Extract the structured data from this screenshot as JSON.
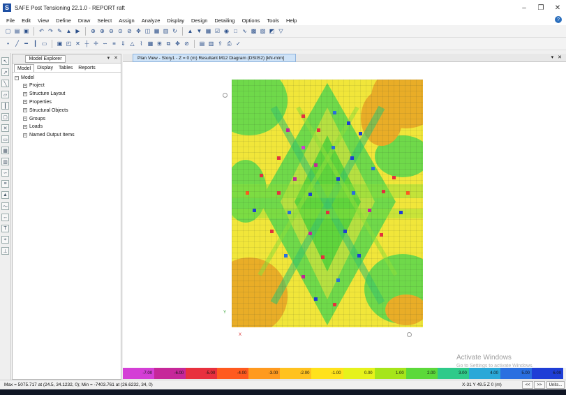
{
  "window": {
    "title": "SAFE Post Tensioning 22.1.0 - REPORT raft",
    "icon_letter": "S",
    "minimize": "–",
    "restore": "❐",
    "close": "✕"
  },
  "menu": [
    "File",
    "Edit",
    "View",
    "Define",
    "Draw",
    "Select",
    "Assign",
    "Analyze",
    "Display",
    "Design",
    "Detailing",
    "Options",
    "Tools",
    "Help"
  ],
  "explorer": {
    "title": "Model Explorer",
    "pin": "▾",
    "close": "✕",
    "tabs": [
      "Model",
      "Display",
      "Tables",
      "Reports"
    ],
    "root": "Model",
    "items": [
      "Project",
      "Structure Layout",
      "Properties",
      "Structural Objects",
      "Groups",
      "Loads",
      "Named Output Items"
    ]
  },
  "plan_view": {
    "tab_title": "Plan View - Story1 - Z = 0 (m)   Resultant M12 Diagram   (DStlS2)  [kN-m/m]",
    "close": "✕",
    "x_axis_label": "X",
    "y_axis_label": "Y"
  },
  "legend": {
    "values": [
      "-7.00",
      "-6.00",
      "-5.00",
      "-4.00",
      "-3.00",
      "-2.00",
      "-1.00",
      "0.00",
      "1.00",
      "2.00",
      "3.00",
      "4.00",
      "5.00",
      "6.00"
    ],
    "colors": [
      "#d43fd6",
      "#c6279a",
      "#e8303e",
      "#ff5a1f",
      "#ff9a1f",
      "#ffc21f",
      "#ffe21c",
      "#e6f21c",
      "#a6e51a",
      "#5cd93a",
      "#2fca8a",
      "#2aa8d8",
      "#2a6fe0",
      "#1f3ed6"
    ]
  },
  "status": {
    "minmax": "Max = 5075.717 at (24.5, 34.1232, 0);  Min = -7403.761 at (26.6232, 34, 0)",
    "coords": "X-31  Y 49.5  Z 0 (m)",
    "prev": "<<",
    "next": ">>",
    "units": "Units..."
  },
  "watermark": {
    "line1": "Activate Windows",
    "line2": "Go to Settings to activate Windows."
  },
  "colors": {
    "contour_green": "#6fd94a",
    "contour_yellow": "#f1e63a",
    "contour_orange": "#e9ad27",
    "tab_blue": "#cfe3f7"
  }
}
